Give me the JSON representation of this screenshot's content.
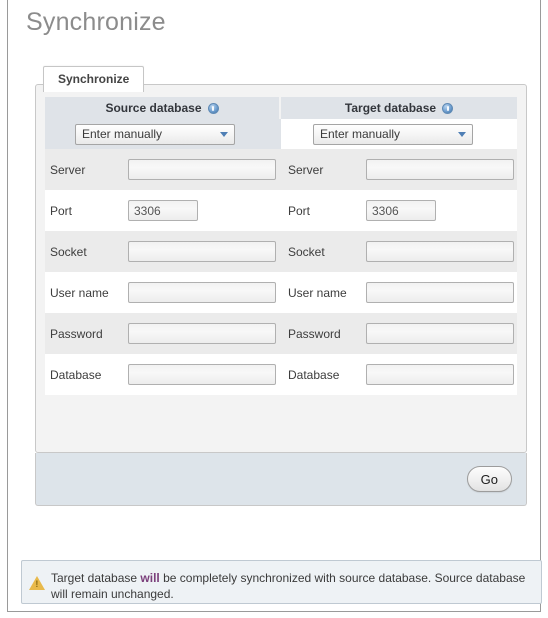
{
  "page": {
    "title": "Synchronize"
  },
  "tabs": [
    {
      "label": "Synchronize",
      "active": true
    }
  ],
  "columns": {
    "source": {
      "header": "Source database",
      "help_icon": "help-icon",
      "select_value": "Enter manually",
      "fields": [
        {
          "label": "Server",
          "value": ""
        },
        {
          "label": "Port",
          "value": "3306"
        },
        {
          "label": "Socket",
          "value": ""
        },
        {
          "label": "User name",
          "value": ""
        },
        {
          "label": "Password",
          "value": ""
        },
        {
          "label": "Database",
          "value": ""
        }
      ]
    },
    "target": {
      "header": "Target database",
      "help_icon": "help-icon",
      "select_value": "Enter manually",
      "fields": [
        {
          "label": "Server",
          "value": ""
        },
        {
          "label": "Port",
          "value": "3306"
        },
        {
          "label": "Socket",
          "value": ""
        },
        {
          "label": "User name",
          "value": ""
        },
        {
          "label": "Password",
          "value": ""
        },
        {
          "label": "Database",
          "value": ""
        }
      ]
    }
  },
  "footer": {
    "go_label": "Go"
  },
  "notice": {
    "icon": "warning-triangle-icon",
    "text_before": "Target database ",
    "emphasis": "will",
    "text_after": " be completely synchronized with source database. Source database will remain unchanged."
  },
  "colors": {
    "header_band": "#dfe3e8",
    "footer_band": "#dde4ea",
    "notice_bg": "#eef2f5",
    "emphasis": "#7b3f7b",
    "title": "#8c8c8c",
    "warning": "#e8b94b"
  }
}
